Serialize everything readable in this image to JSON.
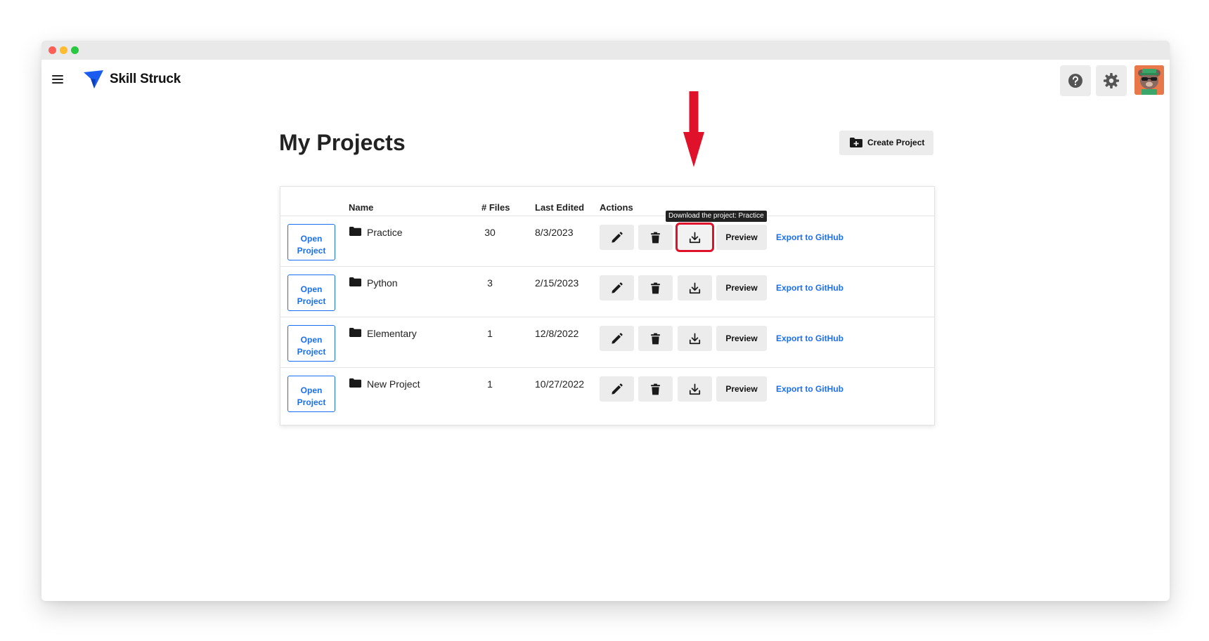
{
  "app": {
    "brand": "Skill Struck"
  },
  "header": {
    "help_icon": "question-circle-icon",
    "settings_icon": "gear-icon",
    "avatar_icon": "bear-avatar"
  },
  "page": {
    "title": "My Projects",
    "create_label": "Create Project"
  },
  "table": {
    "headers": {
      "name": "Name",
      "files": "# Files",
      "edited": "Last Edited",
      "actions": "Actions"
    },
    "open_label": "Open Project",
    "preview_label": "Preview",
    "export_label": "Export to GitHub",
    "rows": [
      {
        "name": "Practice",
        "files": "30",
        "edited": "8/3/2023"
      },
      {
        "name": "Python",
        "files": "3",
        "edited": "2/15/2023"
      },
      {
        "name": "Elementary",
        "files": "1",
        "edited": "12/8/2022"
      },
      {
        "name": "New Project",
        "files": "1",
        "edited": "10/27/2022"
      }
    ]
  },
  "tooltip": "Download the project: Practice",
  "colors": {
    "accent": "#1a6ef0",
    "highlight": "#e0112b",
    "button_bg": "#ececec"
  }
}
